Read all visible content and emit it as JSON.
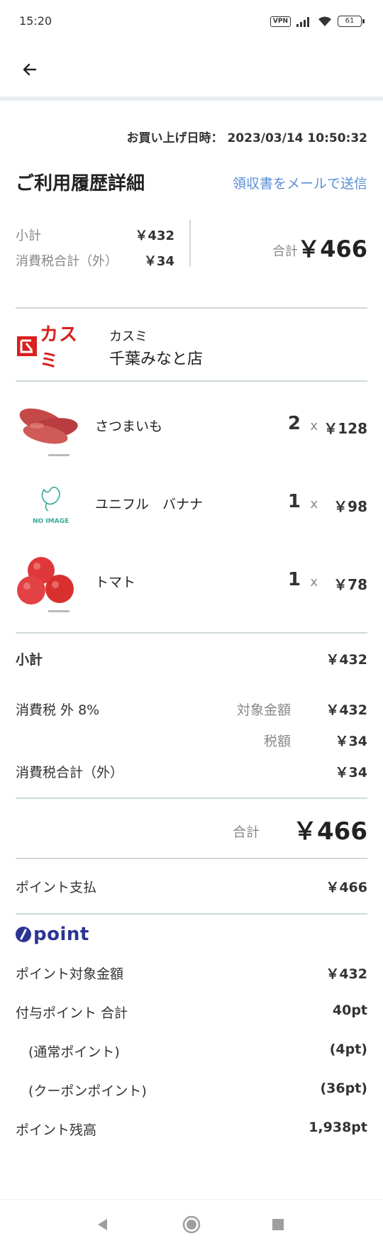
{
  "status_bar": {
    "time": "15:20",
    "vpn": "VPN",
    "battery": "61"
  },
  "header": {
    "back_icon": "arrow-left-icon"
  },
  "purchase": {
    "datetime_label": "お買い上げ日時：",
    "datetime_value": "2023/03/14 10:50:32"
  },
  "title": "ご利用履歴詳細",
  "receipt_link": "領収書をメールで送信",
  "summary": {
    "subtotal_label": "小計",
    "subtotal_value": "￥432",
    "tax_label": "消費税合計（外）",
    "tax_value": "￥34",
    "total_label": "合計",
    "total_value": "￥466"
  },
  "store": {
    "logo_text": "カスミ",
    "chain_name": "カスミ",
    "branch_name": "千葉みなと店"
  },
  "items": [
    {
      "name": "さつまいも",
      "qty": "2",
      "x": "x",
      "price": "￥128",
      "image": "sweet-potato-image"
    },
    {
      "name": "ユニフル　バナナ",
      "qty": "1",
      "x": "x",
      "price": "￥98",
      "image": "no-image-placeholder",
      "no_image_text": "NO IMAGE"
    },
    {
      "name": "トマト",
      "qty": "1",
      "x": "x",
      "price": "￥78",
      "image": "tomato-image"
    }
  ],
  "breakdown": {
    "subtotal_label": "小計",
    "subtotal_value": "￥432",
    "tax_rate_label": "消費税 外 8%",
    "target_label": "対象金額",
    "target_value": "￥432",
    "tax_amount_label": "税額",
    "tax_amount_value": "￥34",
    "tax_total_label": "消費税合計（外）",
    "tax_total_value": "￥34",
    "grand_label": "合計",
    "grand_value": "￥466"
  },
  "payment": {
    "label": "ポイント支払",
    "value": "￥466"
  },
  "points": {
    "logo_text": "point",
    "target_label": "ポイント対象金額",
    "target_value": "￥432",
    "granted_label": "付与ポイント 合計",
    "granted_value": "40pt",
    "normal_label": "(通常ポイント)",
    "normal_value": "(4pt)",
    "coupon_label": "(クーポンポイント)",
    "coupon_value": "(36pt)",
    "balance_label": "ポイント残高",
    "balance_value": "1,938pt"
  },
  "nav": {
    "back": "triangle-back-icon",
    "home": "circle-home-icon",
    "recents": "square-recents-icon"
  },
  "colors": {
    "accent_link": "#5b8fd6",
    "brand_red": "#d8201f",
    "point_navy": "#2a3592",
    "divider": "#cfd8dc"
  }
}
